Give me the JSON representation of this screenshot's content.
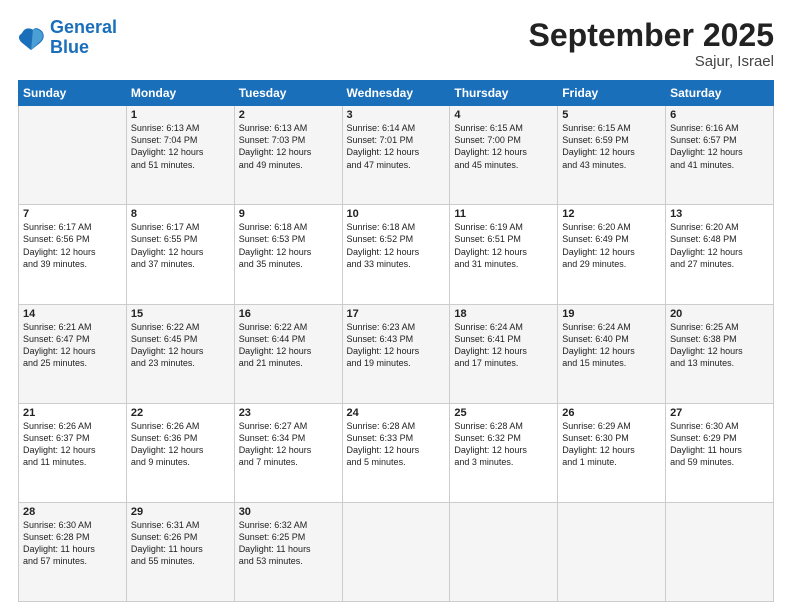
{
  "header": {
    "logo_line1": "General",
    "logo_line2": "Blue",
    "month": "September 2025",
    "location": "Sajur, Israel"
  },
  "days_of_week": [
    "Sunday",
    "Monday",
    "Tuesday",
    "Wednesday",
    "Thursday",
    "Friday",
    "Saturday"
  ],
  "weeks": [
    [
      {
        "day": "",
        "content": ""
      },
      {
        "day": "1",
        "content": "Sunrise: 6:13 AM\nSunset: 7:04 PM\nDaylight: 12 hours\nand 51 minutes."
      },
      {
        "day": "2",
        "content": "Sunrise: 6:13 AM\nSunset: 7:03 PM\nDaylight: 12 hours\nand 49 minutes."
      },
      {
        "day": "3",
        "content": "Sunrise: 6:14 AM\nSunset: 7:01 PM\nDaylight: 12 hours\nand 47 minutes."
      },
      {
        "day": "4",
        "content": "Sunrise: 6:15 AM\nSunset: 7:00 PM\nDaylight: 12 hours\nand 45 minutes."
      },
      {
        "day": "5",
        "content": "Sunrise: 6:15 AM\nSunset: 6:59 PM\nDaylight: 12 hours\nand 43 minutes."
      },
      {
        "day": "6",
        "content": "Sunrise: 6:16 AM\nSunset: 6:57 PM\nDaylight: 12 hours\nand 41 minutes."
      }
    ],
    [
      {
        "day": "7",
        "content": "Sunrise: 6:17 AM\nSunset: 6:56 PM\nDaylight: 12 hours\nand 39 minutes."
      },
      {
        "day": "8",
        "content": "Sunrise: 6:17 AM\nSunset: 6:55 PM\nDaylight: 12 hours\nand 37 minutes."
      },
      {
        "day": "9",
        "content": "Sunrise: 6:18 AM\nSunset: 6:53 PM\nDaylight: 12 hours\nand 35 minutes."
      },
      {
        "day": "10",
        "content": "Sunrise: 6:18 AM\nSunset: 6:52 PM\nDaylight: 12 hours\nand 33 minutes."
      },
      {
        "day": "11",
        "content": "Sunrise: 6:19 AM\nSunset: 6:51 PM\nDaylight: 12 hours\nand 31 minutes."
      },
      {
        "day": "12",
        "content": "Sunrise: 6:20 AM\nSunset: 6:49 PM\nDaylight: 12 hours\nand 29 minutes."
      },
      {
        "day": "13",
        "content": "Sunrise: 6:20 AM\nSunset: 6:48 PM\nDaylight: 12 hours\nand 27 minutes."
      }
    ],
    [
      {
        "day": "14",
        "content": "Sunrise: 6:21 AM\nSunset: 6:47 PM\nDaylight: 12 hours\nand 25 minutes."
      },
      {
        "day": "15",
        "content": "Sunrise: 6:22 AM\nSunset: 6:45 PM\nDaylight: 12 hours\nand 23 minutes."
      },
      {
        "day": "16",
        "content": "Sunrise: 6:22 AM\nSunset: 6:44 PM\nDaylight: 12 hours\nand 21 minutes."
      },
      {
        "day": "17",
        "content": "Sunrise: 6:23 AM\nSunset: 6:43 PM\nDaylight: 12 hours\nand 19 minutes."
      },
      {
        "day": "18",
        "content": "Sunrise: 6:24 AM\nSunset: 6:41 PM\nDaylight: 12 hours\nand 17 minutes."
      },
      {
        "day": "19",
        "content": "Sunrise: 6:24 AM\nSunset: 6:40 PM\nDaylight: 12 hours\nand 15 minutes."
      },
      {
        "day": "20",
        "content": "Sunrise: 6:25 AM\nSunset: 6:38 PM\nDaylight: 12 hours\nand 13 minutes."
      }
    ],
    [
      {
        "day": "21",
        "content": "Sunrise: 6:26 AM\nSunset: 6:37 PM\nDaylight: 12 hours\nand 11 minutes."
      },
      {
        "day": "22",
        "content": "Sunrise: 6:26 AM\nSunset: 6:36 PM\nDaylight: 12 hours\nand 9 minutes."
      },
      {
        "day": "23",
        "content": "Sunrise: 6:27 AM\nSunset: 6:34 PM\nDaylight: 12 hours\nand 7 minutes."
      },
      {
        "day": "24",
        "content": "Sunrise: 6:28 AM\nSunset: 6:33 PM\nDaylight: 12 hours\nand 5 minutes."
      },
      {
        "day": "25",
        "content": "Sunrise: 6:28 AM\nSunset: 6:32 PM\nDaylight: 12 hours\nand 3 minutes."
      },
      {
        "day": "26",
        "content": "Sunrise: 6:29 AM\nSunset: 6:30 PM\nDaylight: 12 hours\nand 1 minute."
      },
      {
        "day": "27",
        "content": "Sunrise: 6:30 AM\nSunset: 6:29 PM\nDaylight: 11 hours\nand 59 minutes."
      }
    ],
    [
      {
        "day": "28",
        "content": "Sunrise: 6:30 AM\nSunset: 6:28 PM\nDaylight: 11 hours\nand 57 minutes."
      },
      {
        "day": "29",
        "content": "Sunrise: 6:31 AM\nSunset: 6:26 PM\nDaylight: 11 hours\nand 55 minutes."
      },
      {
        "day": "30",
        "content": "Sunrise: 6:32 AM\nSunset: 6:25 PM\nDaylight: 11 hours\nand 53 minutes."
      },
      {
        "day": "",
        "content": ""
      },
      {
        "day": "",
        "content": ""
      },
      {
        "day": "",
        "content": ""
      },
      {
        "day": "",
        "content": ""
      }
    ]
  ]
}
